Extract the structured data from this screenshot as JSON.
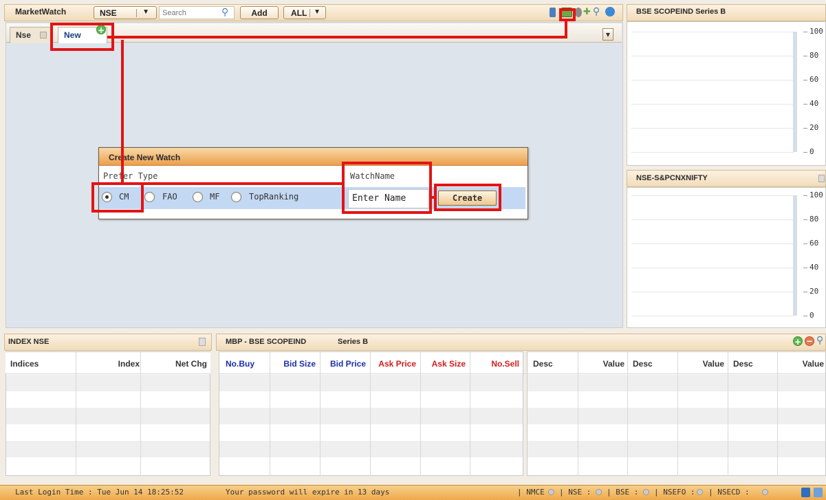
{
  "marketwatch": {
    "title": "MarketWatch",
    "exchange_selected": "NSE",
    "search_placeholder": "Search",
    "add_label": "Add",
    "filter_selected": "ALL",
    "tabs": [
      {
        "label": "Nse"
      },
      {
        "label": "New"
      }
    ]
  },
  "dialog": {
    "title": "Create New Watch",
    "prefer_type_label": "Prefer Type",
    "watchname_label": "WatchName",
    "options": [
      "CM",
      "FAO",
      "MF",
      "TopRanking"
    ],
    "selected_option": "CM",
    "name_value": "Enter Name",
    "create_label": "Create"
  },
  "charts": [
    {
      "title": "BSE SCOPEIND  Series B",
      "ticks": [
        "100",
        "80",
        "60",
        "40",
        "20",
        "0"
      ]
    },
    {
      "title": "NSE-S&PCNXNIFTY",
      "ticks": [
        "100",
        "80",
        "60",
        "40",
        "20",
        "0"
      ]
    }
  ],
  "index_panel": {
    "title": "INDEX NSE",
    "columns": [
      "Indices",
      "Index",
      "Net Chg"
    ]
  },
  "mbp_panel": {
    "title": "MBP - BSE  SCOPEIND",
    "series": "Series B",
    "columns": [
      {
        "label": "No.Buy",
        "color": "#1a2fa8"
      },
      {
        "label": "Bid Size",
        "color": "#1a2fa8"
      },
      {
        "label": "Bid Price",
        "color": "#1a2fa8"
      },
      {
        "label": "Ask Price",
        "color": "#d41c1c"
      },
      {
        "label": "Ask Size",
        "color": "#d41c1c"
      },
      {
        "label": "No.Sell",
        "color": "#d41c1c"
      }
    ],
    "desc_columns": [
      "Desc",
      "Value",
      "Desc",
      "Value",
      "Desc",
      "Value"
    ]
  },
  "status": {
    "last_login": "Last Login Time : Tue Jun 14 18:25:52",
    "password_msg": "Your password will expire in 13 days",
    "exchanges": [
      "| NMCE",
      "| NSE :",
      "| BSE :",
      "| NSEFO :",
      "| NSECD :"
    ]
  }
}
